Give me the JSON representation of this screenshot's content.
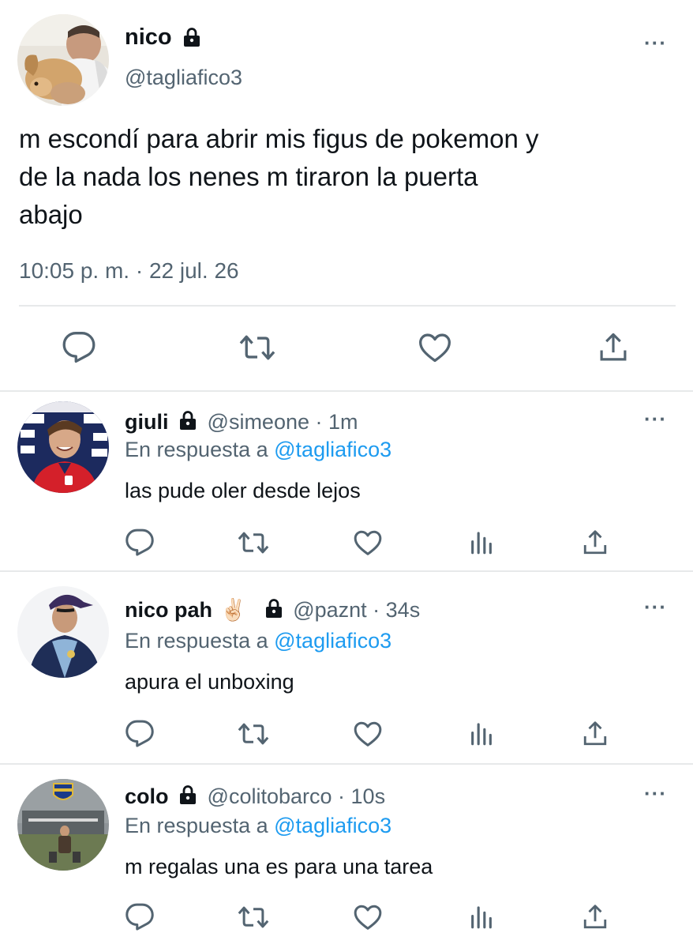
{
  "main_tweet": {
    "name": "nico",
    "handle": "@tagliafico3",
    "text_lines": [
      "m escondí para abrir mis figus de pokemon y",
      "de la nada los nenes m tiraron la puerta",
      "abajo"
    ],
    "timestamp": "10:05 p. m. · 22 jul. 26"
  },
  "replies": [
    {
      "name": "giuli",
      "emoji": "",
      "handle": "@simeone",
      "time": "· 1m",
      "reply_prefix": "En respuesta a",
      "reply_to": "@tagliafico3",
      "text": "las pude oler desde lejos"
    },
    {
      "name": "nico pah",
      "emoji": "✌🏻",
      "handle": "@paznt",
      "time": "· 34s",
      "reply_prefix": "En respuesta a",
      "reply_to": "@tagliafico3",
      "text": "apura el unboxing"
    },
    {
      "name": "colo",
      "emoji": "",
      "handle": "@colitobarco",
      "time": "· 10s",
      "reply_prefix": "En respuesta a",
      "reply_to": "@tagliafico3",
      "text": "m regalas una es para una tarea"
    }
  ],
  "icons": {
    "more": "more-dots-icon",
    "lock": "lock-icon",
    "reply": "reply-icon",
    "retweet": "retweet-icon",
    "like": "heart-icon",
    "views": "views-icon",
    "share": "share-icon"
  },
  "colors": {
    "text": "#0f1419",
    "secondary": "#536471",
    "link": "#1d9bf0",
    "divider": "#e7e9ea"
  }
}
